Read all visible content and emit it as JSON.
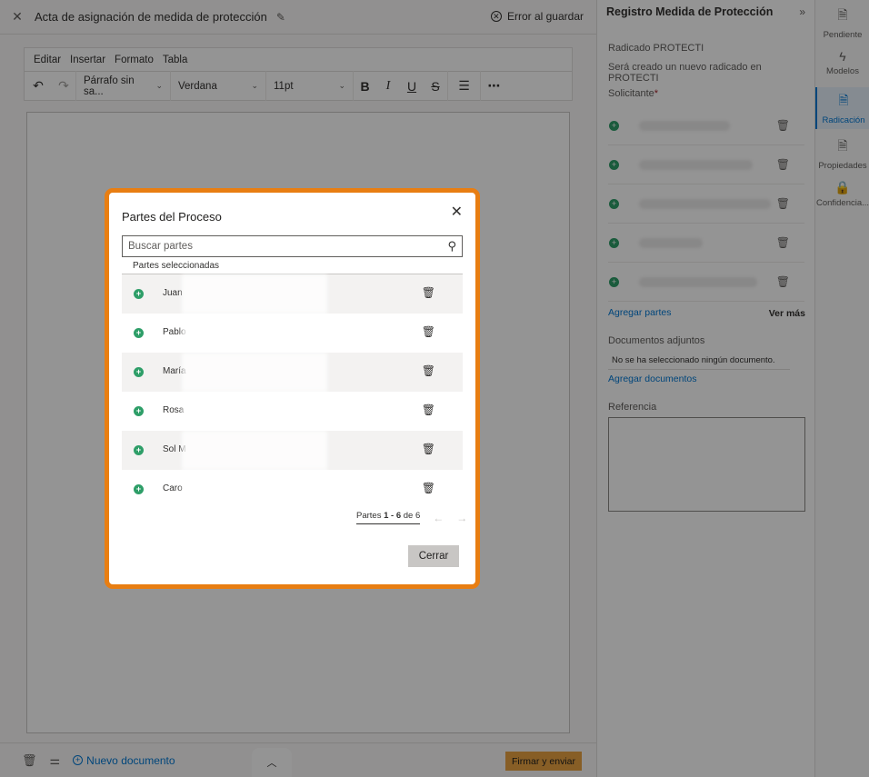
{
  "editor": {
    "document_title": "Acta de asignación de medida de protección",
    "save_error": "Error al guardar",
    "menu": [
      "Editar",
      "Insertar",
      "Formato",
      "Tabla"
    ],
    "toolbar": {
      "paragraph_style": "Párrafo sin sa...",
      "font_family": "Verdana",
      "font_size": "11pt"
    },
    "footer": {
      "new_document": "Nuevo documento",
      "sign_and_send": "Firmar y enviar"
    }
  },
  "form_panel": {
    "title": "Registro Medida de Protección",
    "radicado_label": "Radicado PROTECTI",
    "radicado_text": "Será creado un nuevo radicado en PROTECTI",
    "solicitante_label": "Solicitante",
    "solicitante_required": "*",
    "add_parts": "Agregar partes",
    "see_more": "Ver más",
    "attachments_label": "Documentos adjuntos",
    "no_document": "No se ha seleccionado ningún documento.",
    "add_documents": "Agregar documentos",
    "reference_label": "Referencia"
  },
  "rail": {
    "items": [
      {
        "label": "Pendiente",
        "icon": "document-clock-icon"
      },
      {
        "label": "Modelos",
        "icon": "lightning-icon"
      },
      {
        "label": "Radicación",
        "icon": "document-search-icon",
        "active": true
      },
      {
        "label": "Propiedades",
        "icon": "document-properties-icon"
      },
      {
        "label": "Confidencia...",
        "icon": "lock-icon"
      }
    ]
  },
  "modal": {
    "title": "Partes del Proceso",
    "search_placeholder": "Buscar partes",
    "selected_label": "Partes seleccionadas",
    "parts": [
      {
        "name": "Juan"
      },
      {
        "name": "Pablo"
      },
      {
        "name": "María"
      },
      {
        "name": "Rosa"
      },
      {
        "name": "Sol M"
      },
      {
        "name": "Caro"
      }
    ],
    "pagination": {
      "prefix": "Partes",
      "range": "1 - 6",
      "suffix": "de 6"
    },
    "close_button": "Cerrar"
  },
  "colors": {
    "modal_border": "#e87e12",
    "add_icon": "#2e9e68",
    "link": "#0078d4",
    "sign_button": "#e8a343"
  }
}
